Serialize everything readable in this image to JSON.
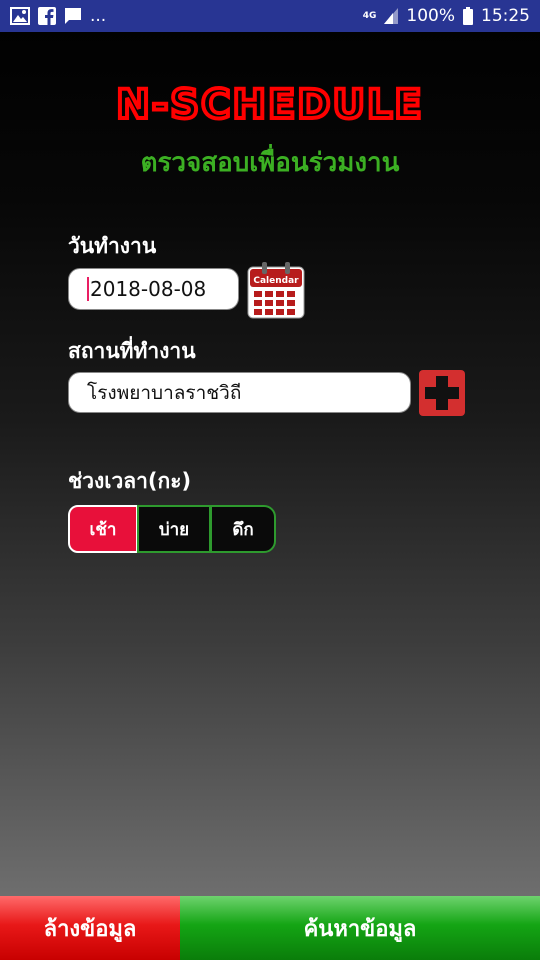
{
  "status_bar": {
    "icons_left": [
      "image-icon",
      "facebook-icon",
      "message-icon"
    ],
    "more": "...",
    "network": "4G",
    "battery": "100%",
    "time": "15:25"
  },
  "header": {
    "logo_text": "N-SCHEDULE",
    "subtitle": "ตรวจสอบเพื่อนร่วมงาน"
  },
  "form": {
    "date_label": "วันทำงาน",
    "date_value": "2018-08-08",
    "calendar_icon_text": "Calendar",
    "location_label": "สถานที่ทำงาน",
    "location_value": "โรงพยาบาลราชวิถี",
    "shift_label": "ช่วงเวลา(กะ)",
    "shifts": [
      "เช้า",
      "บ่าย",
      "ดึก"
    ],
    "selected_shift": "เช้า"
  },
  "buttons": {
    "clear": "ล้างข้อมูล",
    "search": "ค้นหาข้อมูล"
  },
  "colors": {
    "status_bar": "#283593",
    "logo": "#ff0000",
    "subtitle": "#3cb023",
    "selected_shift": "#e8103a",
    "clear_button": "#e81818",
    "search_button": "#14a514"
  }
}
